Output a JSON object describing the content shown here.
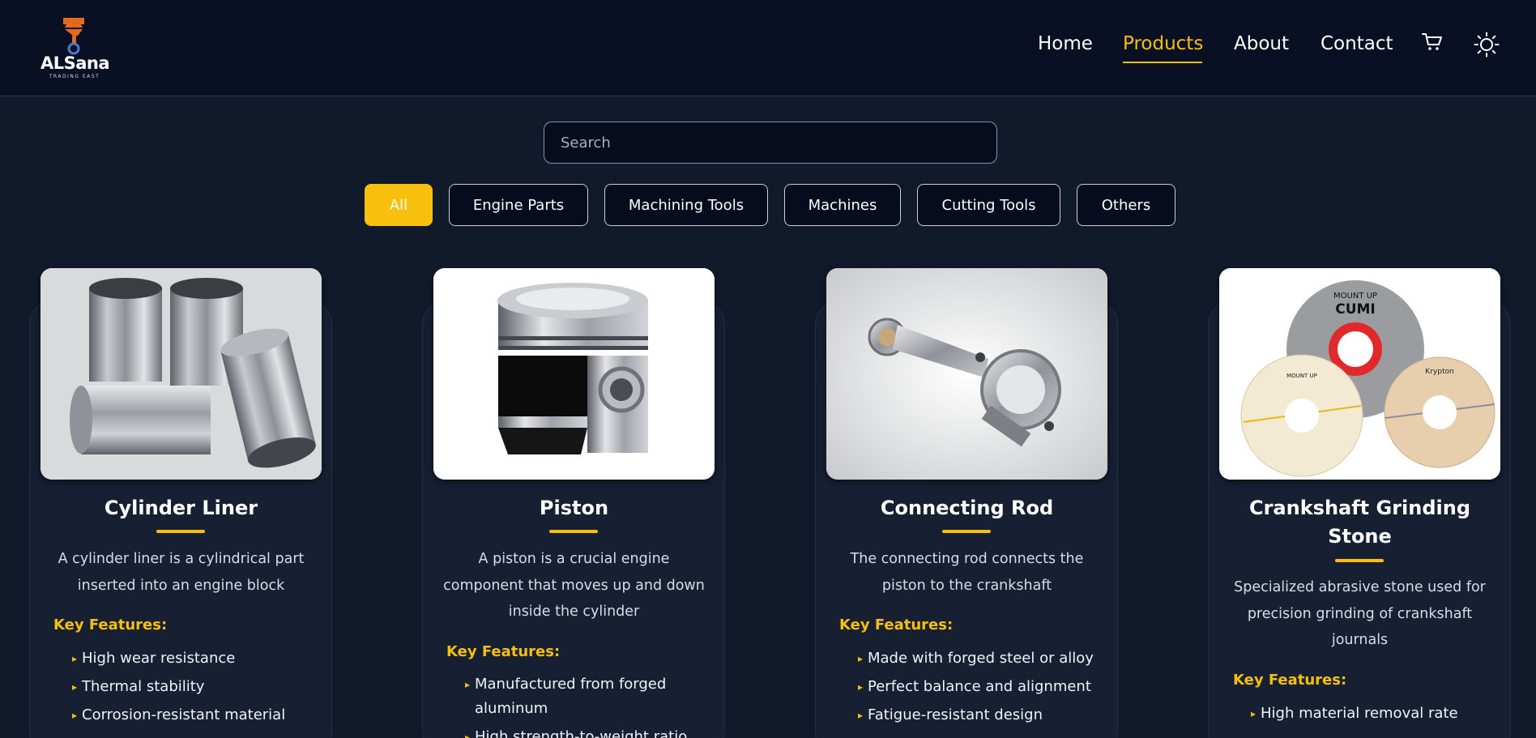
{
  "brand": {
    "name": "ALSana",
    "tagline": "TRADING EAST"
  },
  "nav": {
    "links": [
      {
        "label": "Home"
      },
      {
        "label": "Products"
      },
      {
        "label": "About"
      },
      {
        "label": "Contact"
      }
    ],
    "active": "Products",
    "cart_icon": "cart-icon",
    "theme_icon": "sun-icon"
  },
  "search": {
    "placeholder": "Search",
    "value": ""
  },
  "filters": {
    "selected": "All",
    "options": [
      "All",
      "Engine Parts",
      "Machining Tools",
      "Machines",
      "Cutting Tools",
      "Others"
    ]
  },
  "products": [
    {
      "title": "Cylinder Liner",
      "description": "A cylinder liner is a cylindrical part inserted into an engine block",
      "key_features_label": "Key Features:",
      "features": [
        "High wear resistance",
        "Thermal stability",
        "Corrosion-resistant material"
      ]
    },
    {
      "title": "Piston",
      "description": "A piston is a crucial engine component that moves up and down inside the cylinder",
      "key_features_label": "Key Features:",
      "features": [
        "Manufactured from forged aluminum",
        "High strength-to-weight ratio"
      ]
    },
    {
      "title": "Connecting Rod",
      "description": "The connecting rod connects the piston to the crankshaft",
      "key_features_label": "Key Features:",
      "features": [
        "Made with forged steel or alloy",
        "Perfect balance and alignment",
        "Fatigue-resistant design"
      ]
    },
    {
      "title": "Crankshaft Grinding Stone",
      "description": "Specialized abrasive stone used for precision grinding of crankshaft journals",
      "key_features_label": "Key Features:",
      "features": [
        "High material removal rate"
      ],
      "image_labels": [
        "MOUNT UP",
        "CUMI",
        "MOUNT UP",
        "Krypton"
      ]
    }
  ],
  "colors": {
    "accent": "#f8c00c",
    "header_bg": "#0a1024",
    "page_bg": "#111a2b",
    "card_bg": "#172033"
  }
}
